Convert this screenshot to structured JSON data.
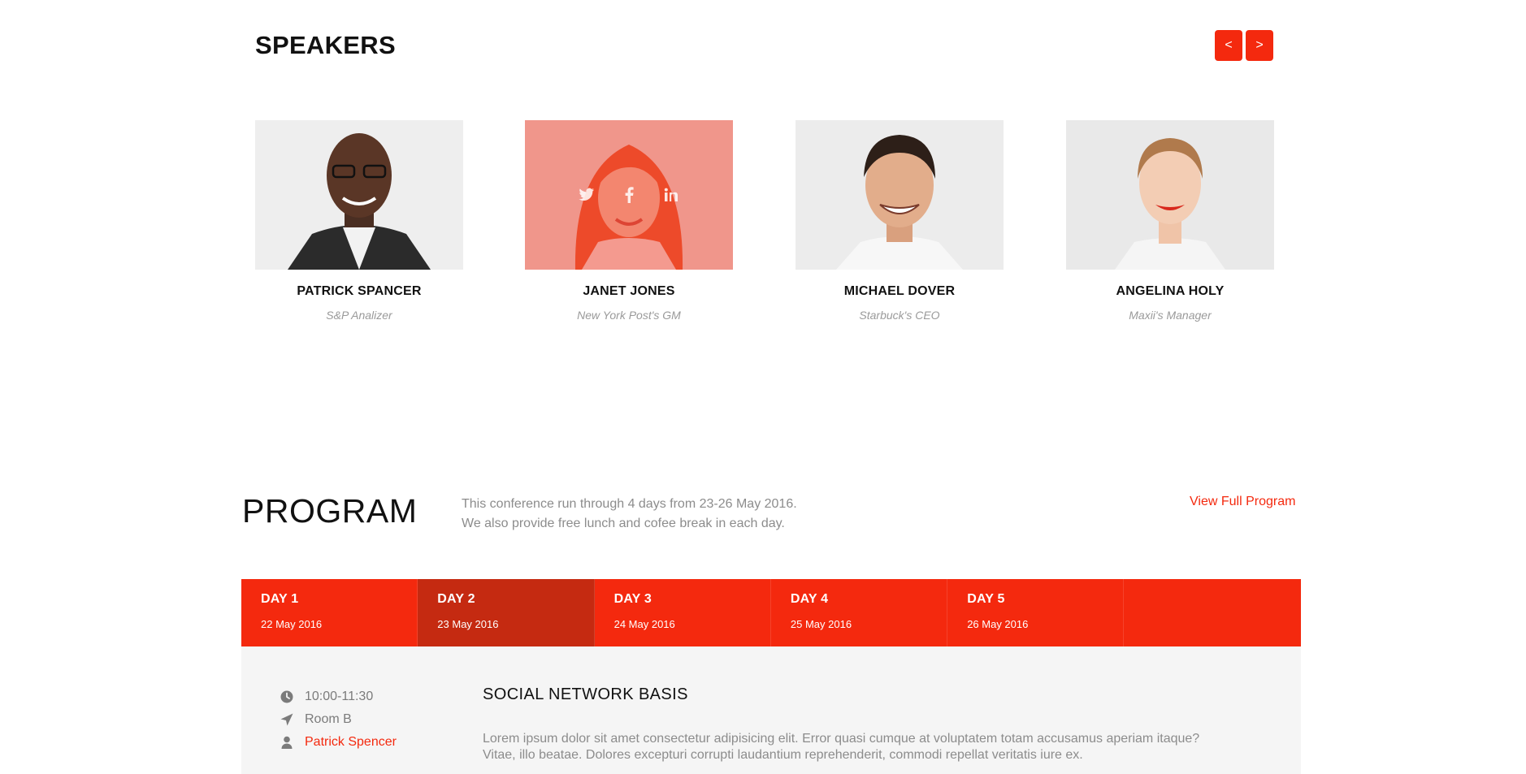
{
  "speakers_section": {
    "title": "SPEAKERS",
    "prev_label": "<",
    "next_label": ">",
    "speakers": [
      {
        "name": "PATRICK SPANCER",
        "role": "S&P Analizer"
      },
      {
        "name": "JANET JONES",
        "role": "New York Post's GM"
      },
      {
        "name": "MICHAEL DOVER",
        "role": "Starbuck's CEO"
      },
      {
        "name": "ANGELINA HOLY",
        "role": "Maxii's Manager"
      }
    ],
    "social_icons": [
      "twitter-icon",
      "facebook-icon",
      "linkedin-icon"
    ]
  },
  "program": {
    "title": "PROGRAM",
    "description_line1": "This conference run through 4 days from 23-26 May 2016.",
    "description_line2": "We also provide free lunch and cofee break in each day.",
    "view_full_label": "View Full Program",
    "days": [
      {
        "name": "DAY 1",
        "date": "22 May 2016"
      },
      {
        "name": "DAY 2",
        "date": "23 May 2016"
      },
      {
        "name": "DAY 3",
        "date": "24 May 2016"
      },
      {
        "name": "DAY 4",
        "date": "25 May 2016"
      },
      {
        "name": "DAY 5",
        "date": "26 May 2016"
      }
    ],
    "active_day": "DAY 2",
    "session": {
      "time": "10:00-11:30",
      "room": "Room B",
      "speaker": "Patrick Spencer",
      "title": "SOCIAL NETWORK BASIS",
      "description_line1": "Lorem ipsum dolor sit amet consectetur adipisicing elit. Error quasi cumque at voluptatem totam accusamus aperiam itaque?",
      "description_line2": "Vitae, illo beatae. Dolores excepturi corrupti laudantium reprehenderit, commodi repellat veritatis iure ex."
    }
  },
  "colors": {
    "accent": "#f4290e",
    "accent_dark": "#c52a11",
    "muted_text": "#8c8c8c",
    "session_bg": "#f5f5f5"
  }
}
